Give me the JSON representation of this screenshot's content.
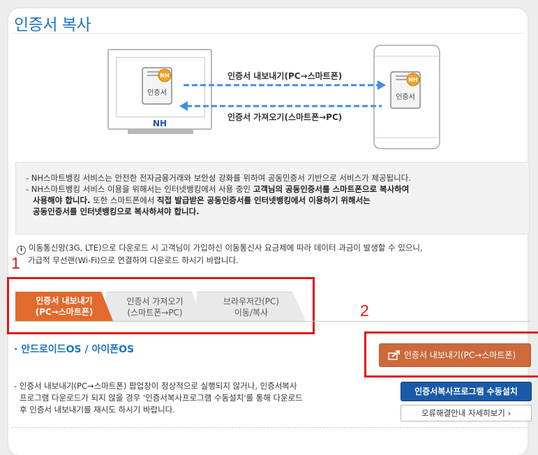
{
  "title": "인증서 복사",
  "diagram": {
    "monitor_brand": "NH",
    "cert_label": "인증서",
    "cert_badge": "NH",
    "export_label": "인증서 내보내기(PC→스마트폰)",
    "import_label": "인증서 가져오기(스마트폰→PC)",
    "colors": {
      "arrow": "#3f8fe6"
    }
  },
  "notice": {
    "line1": "- NH스마트뱅킹 서비스는 안전한 전자금융거래와 보안성 강화를 위하여 공동인증서 기반으로 서비스가 제공됩니다.",
    "line2_pre": "- NH스마트뱅킹 서비스 이용을 위해서는 인터넷뱅킹에서 사용 중인 ",
    "line2_bold": "고객님의 공동인증서를 스마트폰으로 복사하여",
    "line3_bold": "사용해야 합니다.",
    "line3_mid": " 또한 스마트폰에서 ",
    "line3_bold2": "직접 발급받은 공동인증서를 인터넷뱅킹에서 이용하기 위해서는",
    "line4_bold": "공동인증서를 인터넷뱅킹으로 복사하셔야 합니다."
  },
  "info": {
    "icon": "i",
    "line1": "이동통신망(3G, LTE)으로 다운로드 시 고객님이 가입하신 이동통신사 요금제에 따라 데이터 과금이 발생할 수 있으니,",
    "line2": "가급적 무선랜(Wi-Fi)으로 연결하여 다운로드 하시기 바랍니다."
  },
  "annotations": {
    "one": "1",
    "two": "2",
    "color": "#e01616"
  },
  "tabs": [
    {
      "line1": "인증서 내보내기",
      "line2": "(PC→스마트폰)"
    },
    {
      "line1": "인증서 가져오기",
      "line2": "(스마트폰→PC)"
    },
    {
      "line1": "브라우저간(PC)",
      "line2": "이동/복사"
    }
  ],
  "section_title": "· 안드로이드OS / 아이폰OS",
  "export_button": "인증서 내보내기(PC→스마트폰)",
  "footer": {
    "line1": "- 인증서 내보내기(PC→스마트폰) 팝업창이 정상적으로 실행되지 않거나, 인증서복사",
    "line2": "프로그램 다운로드가 되지 않을 경우 '인증서복사프로그램 수동설치'를 통해 다운로드",
    "line3": "후 인증서 내보내기를 재시도 하시기 바랍니다."
  },
  "install_button": "인증서복사프로그램 수동설치",
  "help_button": "오류해결안내 자세히보기 ›"
}
